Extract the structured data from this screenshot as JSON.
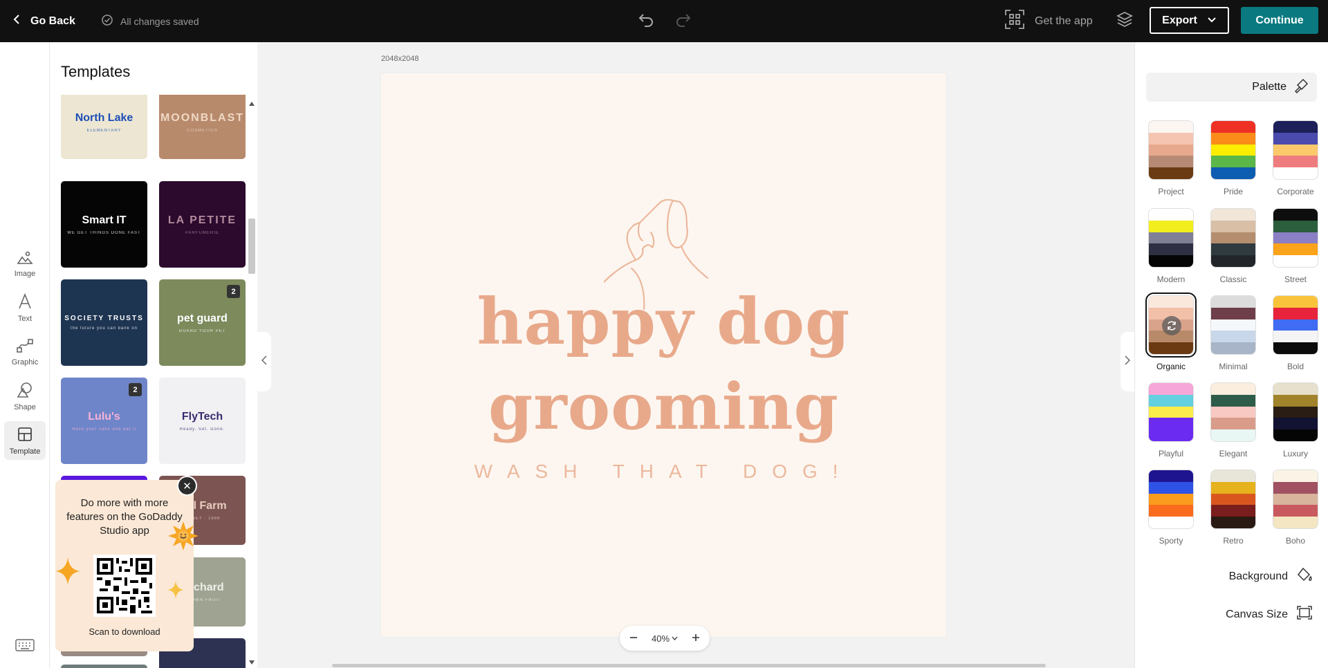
{
  "topbar": {
    "go_back": "Go Back",
    "saved_status": "All changes saved",
    "get_app": "Get the app",
    "export": "Export",
    "continue": "Continue"
  },
  "rail": {
    "items": [
      "Image",
      "Text",
      "Graphic",
      "Shape",
      "Template"
    ],
    "active": "Template"
  },
  "templates": {
    "title": "Templates",
    "items": [
      {
        "name": "North Lake",
        "sub": "ELEMENTARY",
        "bg": "#ece6d3",
        "fg": "#1d4fb5"
      },
      {
        "name": "MOONBLAST",
        "sub": "COSMETICS",
        "bg": "#b88a6c",
        "fg": "#efd8c4"
      },
      {
        "name": "Smart IT",
        "sub": "WE GET THINGS DONE FAST",
        "bg": "#050505",
        "fg": "#ffffff"
      },
      {
        "name": "LA PETITE",
        "sub": "PARFUMERIE",
        "bg": "#2b0a2e",
        "fg": "#b48a9c"
      },
      {
        "name": "SOCIETY TRUSTS",
        "sub": "the future you can bank on",
        "bg": "#1e3552",
        "fg": "#ffffff"
      },
      {
        "name": "pet guard",
        "sub": "GUARD YOUR PET",
        "bg": "#7c8a5c",
        "fg": "#ffffff",
        "badge": "2"
      },
      {
        "name": "Lulu's",
        "sub": "Have your cake and eat it",
        "bg": "#6f85c9",
        "fg": "#f6b3d5",
        "badge": "2"
      },
      {
        "name": "FlyTech",
        "sub": "Ready. Set. Done.",
        "bg": "#f1f0f2",
        "fg": "#3a2b70"
      },
      {
        "name": "",
        "sub": "",
        "bg": "#5a18e0",
        "fg": "#ffffff"
      },
      {
        "name": "Mill Farm",
        "sub": "HONEY · 1986",
        "bg": "#7c5552",
        "fg": "#e8cdbf"
      },
      {
        "name": "",
        "sub": "",
        "bg": "#9a8b84",
        "fg": "#ffffff"
      },
      {
        "name": "Orchard",
        "sub": "GROWN FRUIT",
        "bg": "#9ea392",
        "fg": "#eef0e8"
      },
      {
        "name": "",
        "sub": "",
        "bg": "#6f7a7a",
        "fg": "#ffffff"
      },
      {
        "name": "",
        "sub": "",
        "bg": "#2e3252",
        "fg": "#ffffff"
      }
    ]
  },
  "promo": {
    "text": "Do more with more features on the GoDaddy Studio app",
    "scan": "Scan to download"
  },
  "canvas": {
    "size_label": "2048x2048",
    "line1": "happy dog",
    "line2": "grooming",
    "tagline": "WASH THAT DOG!",
    "zoom": "40%"
  },
  "right_panel": {
    "palette_label": "Palette",
    "background_label": "Background",
    "canvas_size_label": "Canvas Size",
    "selected": "Organic",
    "palettes": [
      {
        "name": "Project",
        "colors": [
          "#fbf6f2",
          "#f5c5b2",
          "#e7a98d",
          "#b68a74",
          "#6b3c13"
        ]
      },
      {
        "name": "Pride",
        "colors": [
          "#ee3124",
          "#fb8c1a",
          "#fdee00",
          "#5ab748",
          "#0d5db0"
        ]
      },
      {
        "name": "Corporate",
        "colors": [
          "#1d1f59",
          "#4b4aad",
          "#fbc96b",
          "#ee7c7f",
          "#ffffff"
        ]
      },
      {
        "name": "Modern",
        "colors": [
          "#ffffff",
          "#f2ee1d",
          "#7f7f96",
          "#2e2f42",
          "#050505"
        ]
      },
      {
        "name": "Classic",
        "colors": [
          "#f2e6d8",
          "#d8bfa6",
          "#b48d6e",
          "#2f3b3f",
          "#22262a"
        ]
      },
      {
        "name": "Street",
        "colors": [
          "#0e0e0e",
          "#2a5e3c",
          "#8b7fc5",
          "#fba31a",
          "#ffffff"
        ]
      },
      {
        "name": "Organic",
        "colors": [
          "#fbe8dc",
          "#f2bfa8",
          "#d9a38b",
          "#b88a6a",
          "#6b3a12"
        ]
      },
      {
        "name": "Minimal",
        "colors": [
          "#dcdcdc",
          "#6e3e4a",
          "#f5f8fb",
          "#c8d8ea",
          "#a8b4c7"
        ]
      },
      {
        "name": "Bold",
        "colors": [
          "#f9c43b",
          "#e8233c",
          "#3f6cf2",
          "#f4f4f4",
          "#0b0b0b"
        ]
      },
      {
        "name": "Playful",
        "colors": [
          "#f6a6d8",
          "#63d0df",
          "#fcec4b",
          "#6b2bf1",
          "#6b2bf1"
        ]
      },
      {
        "name": "Elegant",
        "colors": [
          "#fbeede",
          "#2e5c4a",
          "#f8c8c2",
          "#d99c8a",
          "#e8f7f4"
        ]
      },
      {
        "name": "Luxury",
        "colors": [
          "#e6e0cc",
          "#a0832a",
          "#2a1d14",
          "#121233",
          "#050505"
        ]
      },
      {
        "name": "Sporty",
        "colors": [
          "#1f1490",
          "#2d53e6",
          "#fb9c1e",
          "#fb6b1e",
          "#ffffff"
        ]
      },
      {
        "name": "Retro",
        "colors": [
          "#e8e6d8",
          "#e6b21d",
          "#d9571f",
          "#7a1d1d",
          "#2a1a14"
        ]
      },
      {
        "name": "Boho",
        "colors": [
          "#fbf4e6",
          "#a05262",
          "#d7b49b",
          "#c85a5f",
          "#f4e6c2"
        ]
      }
    ]
  }
}
